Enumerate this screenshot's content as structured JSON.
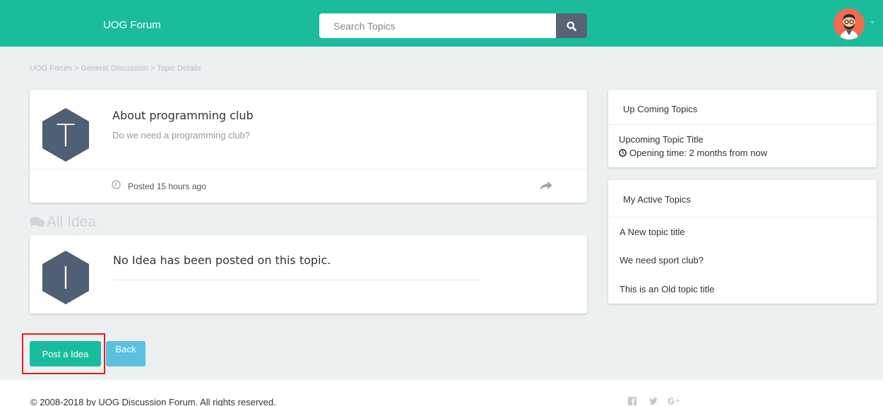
{
  "navbar": {
    "brand": "UOG Forum",
    "search_placeholder": "Search Topics",
    "search_icon": "search-icon",
    "avatar_icon": "user-avatar",
    "accent_color": "#1abc9c"
  },
  "breadcrumb": "UOG Forum > General Discussion > Topic Details",
  "topic": {
    "avatar_letter": "T",
    "title": "About programming club",
    "description": "Do we need a programming club?",
    "posted": "Posted 15 hours ago",
    "clock_icon": "clock-icon",
    "share_icon": "share-icon"
  },
  "ideas": {
    "heading": "All Idea",
    "heading_icon": "comments-icon",
    "avatar_letter": "I",
    "empty_message": "No Idea has been posted on this topic."
  },
  "sidebar": {
    "upcoming": {
      "heading": "Up Coming Topics",
      "item_title": "Upcoming Topic Title",
      "item_time": "Opening time: 2 months from now"
    },
    "active": {
      "heading": "My Active Topics",
      "items": [
        "A New topic title",
        "We need sport club?",
        "This is an Old topic title"
      ]
    }
  },
  "actions": {
    "post_label": "Post a Idea",
    "back_label": "Back"
  },
  "footer": {
    "copyright": "© 2008-2018 by UOG Discussion Forum. All rights reserved.",
    "social": {
      "facebook": "f",
      "twitter": "🐦",
      "google": "G+"
    }
  }
}
